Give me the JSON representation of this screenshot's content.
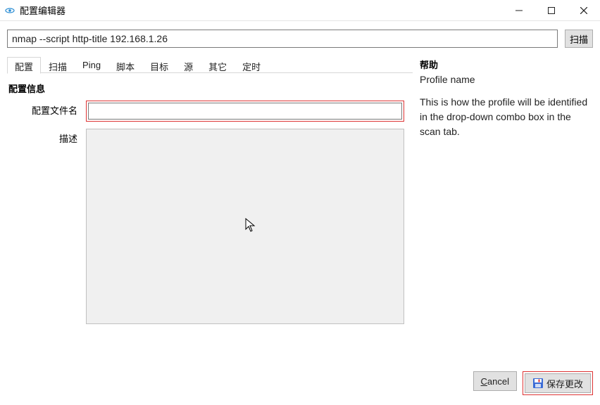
{
  "window": {
    "title": "配置编辑器"
  },
  "command": {
    "value": "nmap --script http-title 192.168.1.26",
    "scan_label": "扫描"
  },
  "tabs": [
    {
      "label": "配置"
    },
    {
      "label": "扫描"
    },
    {
      "label": "Ping"
    },
    {
      "label": "脚本"
    },
    {
      "label": "目标"
    },
    {
      "label": "源"
    },
    {
      "label": "其它"
    },
    {
      "label": "定时"
    }
  ],
  "section": {
    "title": "配置信息",
    "profile_name_label": "配置文件名",
    "profile_name_value": "",
    "description_label": "描述",
    "description_value": ""
  },
  "help": {
    "heading": "帮助",
    "name": "Profile name",
    "body": "This is how the profile will be identified in the drop-down combo box in the scan tab."
  },
  "footer": {
    "cancel_label": "Cancel",
    "save_label": "保存更改"
  }
}
